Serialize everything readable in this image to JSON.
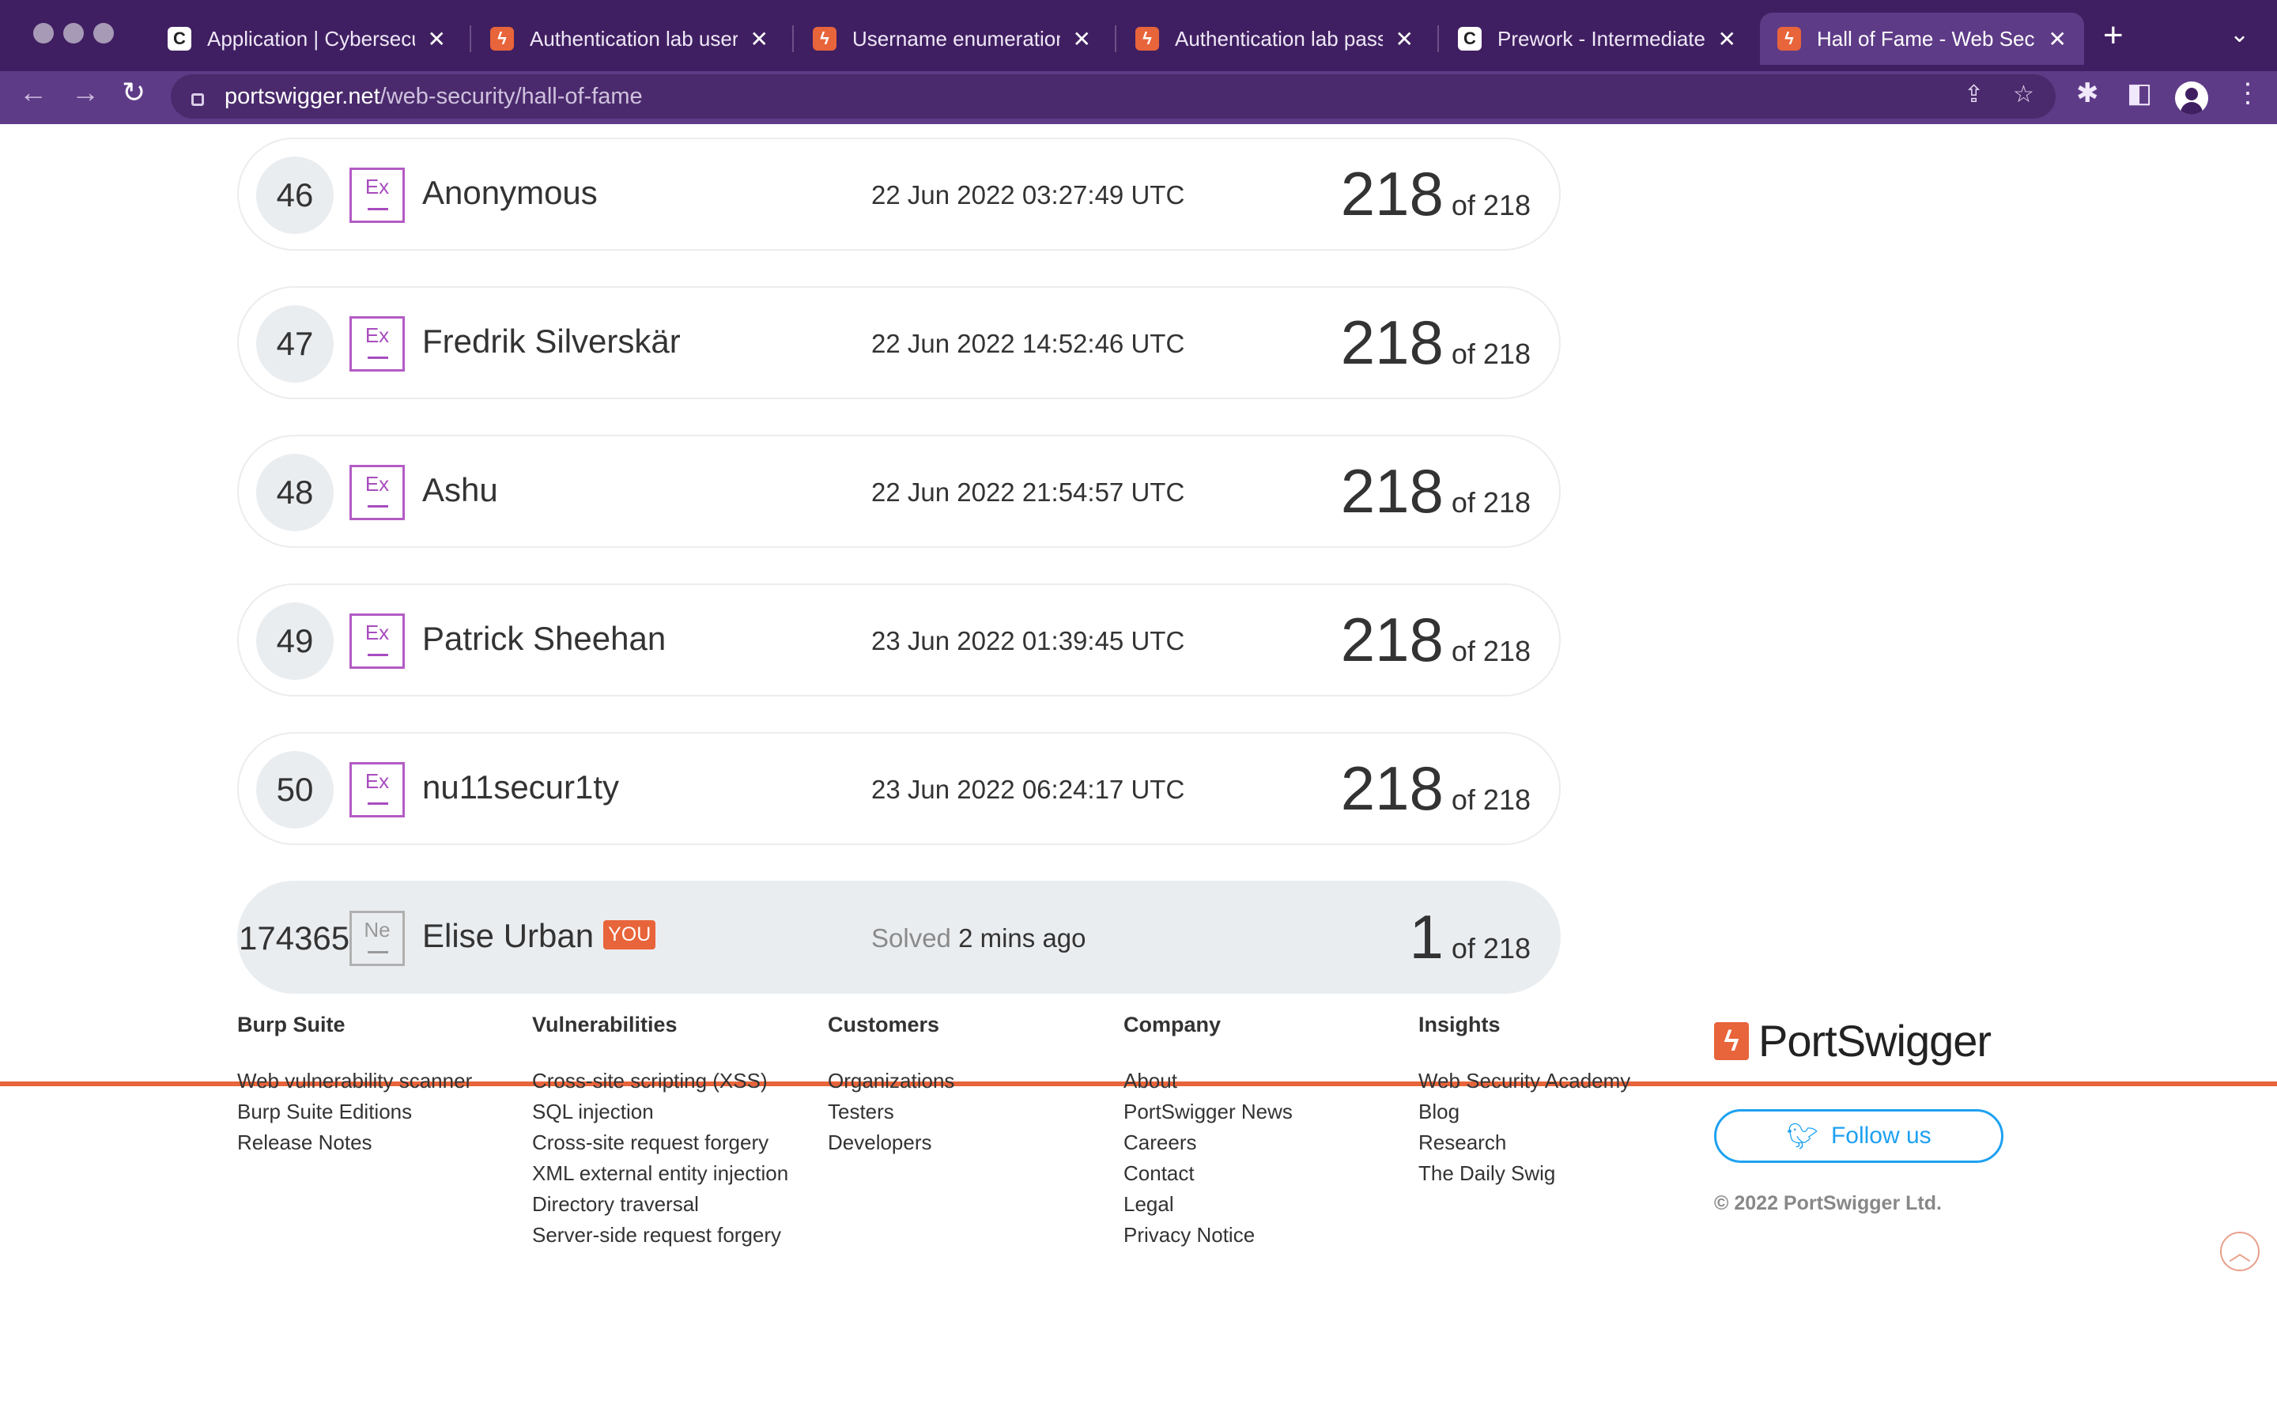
{
  "browser": {
    "tabs": [
      {
        "title": "Application | Cybersecur",
        "favicon": "c"
      },
      {
        "title": "Authentication lab usern",
        "favicon": "b"
      },
      {
        "title": "Username enumeration v",
        "favicon": "b"
      },
      {
        "title": "Authentication lab passw",
        "favicon": "b"
      },
      {
        "title": "Prework - Intermediate C",
        "favicon": "c"
      },
      {
        "title": "Hall of Fame - Web Secu",
        "favicon": "b"
      }
    ],
    "url_host": "portswigger.net",
    "url_path": "/web-security/hall-of-fame"
  },
  "leaderboard": {
    "rows": [
      {
        "rank": "46",
        "badge": "Ex",
        "name": "Anonymous",
        "date": "22 Jun 2022 03:27:49 UTC",
        "score": "218",
        "total": "of 218"
      },
      {
        "rank": "47",
        "badge": "Ex",
        "name": "Fredrik Silverskär",
        "date": "22 Jun 2022 14:52:46 UTC",
        "score": "218",
        "total": "of 218"
      },
      {
        "rank": "48",
        "badge": "Ex",
        "name": "Ashu",
        "date": "22 Jun 2022 21:54:57 UTC",
        "score": "218",
        "total": "of 218"
      },
      {
        "rank": "49",
        "badge": "Ex",
        "name": "Patrick Sheehan",
        "date": "23 Jun 2022 01:39:45 UTC",
        "score": "218",
        "total": "of 218"
      },
      {
        "rank": "50",
        "badge": "Ex",
        "name": "nu11secur1ty",
        "date": "23 Jun 2022 06:24:17 UTC",
        "score": "218",
        "total": "of 218"
      }
    ],
    "you_row": {
      "rank": "174365",
      "badge": "Ne",
      "name": "Elise Urban",
      "tag": "YOU",
      "solved_label": "Solved",
      "solved_time": "2 mins ago",
      "score": "1",
      "total": "of 218"
    }
  },
  "footer": {
    "columns": [
      {
        "heading": "Burp Suite",
        "links": [
          "Web vulnerability scanner",
          "Burp Suite Editions",
          "Release Notes"
        ]
      },
      {
        "heading": "Vulnerabilities",
        "links": [
          "Cross-site scripting (XSS)",
          "SQL injection",
          "Cross-site request forgery",
          "XML external entity injection",
          "Directory traversal",
          "Server-side request forgery"
        ]
      },
      {
        "heading": "Customers",
        "links": [
          "Organizations",
          "Testers",
          "Developers"
        ]
      },
      {
        "heading": "Company",
        "links": [
          "About",
          "PortSwigger News",
          "Careers",
          "Contact",
          "Legal",
          "Privacy Notice"
        ]
      },
      {
        "heading": "Insights",
        "links": [
          "Web Security Academy",
          "Blog",
          "Research",
          "The Daily Swig"
        ]
      }
    ],
    "logo_text": "PortSwigger",
    "follow_label": "Follow us",
    "copyright": "© 2022 PortSwigger Ltd."
  },
  "icons": {
    "back": "back-arrow-icon",
    "forward": "forward-arrow-icon",
    "reload": "reload-icon",
    "share": "share-icon",
    "bookmark": "star-icon",
    "extensions": "puzzle-icon",
    "sidepanel": "side-panel-icon",
    "profile": "avatar-icon",
    "menu": "kebab-menu-icon",
    "twitter": "twitter-bird-icon",
    "scroll_top": "chevron-up-circle-icon"
  },
  "colors": {
    "brand_orange": "#e8643a",
    "browser_purple": "#4d2a6f",
    "badge_purple": "#a84cbf",
    "twitter_blue": "#1da1f2"
  }
}
